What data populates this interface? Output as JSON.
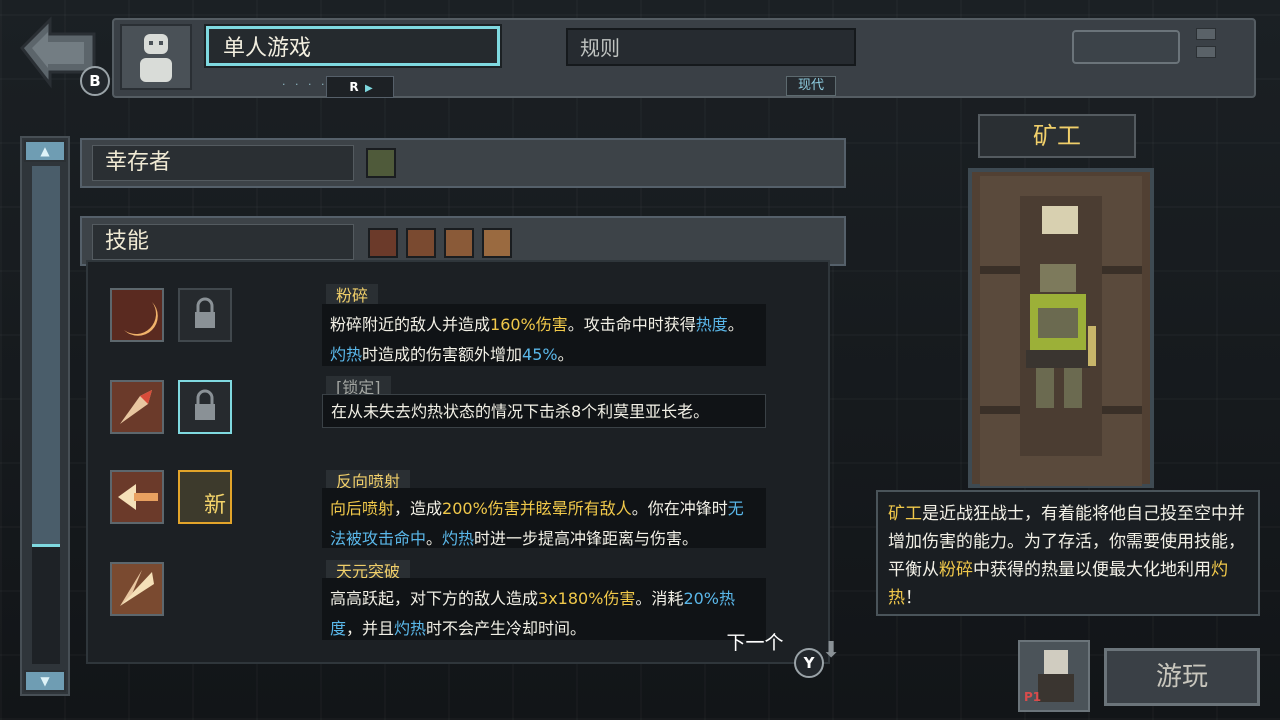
{
  "header": {
    "back_badge": "B",
    "mode_label": "单人游戏",
    "rules_label": "规则",
    "rules_value": "现代",
    "r_badge": "R",
    "dots": "· · · ·"
  },
  "sections": {
    "survivor_label": "幸存者",
    "skills_label": "技能"
  },
  "skills": [
    {
      "title": "粉碎",
      "locked": false
    },
    {
      "title": "[锁定]",
      "locked": true
    },
    {
      "title": "反向喷射",
      "locked": false,
      "new_badge": "新"
    },
    {
      "title": "天元突破",
      "locked": false
    }
  ],
  "skill_text": {
    "s1_a": "粉碎附近的敌人并造成",
    "s1_b": "160%伤害",
    "s1_c": "。攻击命中时获得",
    "s1_d": "热度",
    "s1_e": "。",
    "s1_f": "灼热",
    "s1_g": "时造成的伤害额外增加",
    "s1_h": "45%",
    "s1_i": "。",
    "s2": "在从未失去灼热状态的情况下击杀8个利莫里亚长老。",
    "s3_a": "向后喷射",
    "s3_b": "，造成",
    "s3_c": "200%伤害并眩晕所有敌人",
    "s3_d": "。你在冲锋时",
    "s3_e": "无法被攻击命中",
    "s3_f": "。",
    "s3_g": "灼热",
    "s3_h": "时进一步提高冲锋距离与伤害。",
    "s4_a": "高高跃起，对下方的敌人造成",
    "s4_b": "3x180%伤害",
    "s4_c": "。消耗",
    "s4_d": "20%热度",
    "s4_e": "，并且",
    "s4_f": "灼热",
    "s4_g": "时不会产生冷却时间。"
  },
  "footer": {
    "next_label": "下一个",
    "y_badge": "Y",
    "play_label": "游玩",
    "p1_label": "P1"
  },
  "character": {
    "name": "矿工",
    "desc_a": "矿工",
    "desc_b": "是近战狂战士，有着能将他自己投至空中并增加伤害的能力。为了存活，你需要使用技能，平衡从",
    "desc_c": "粉碎",
    "desc_d": "中获得的热量以便最大化地利用",
    "desc_e": "灼热",
    "desc_f": "！"
  },
  "colors": {
    "accent_cyan": "#7fd9e0",
    "highlight_yellow": "#f0c84a",
    "highlight_blue": "#5ab7e9",
    "new_orange": "#e2a42a"
  }
}
